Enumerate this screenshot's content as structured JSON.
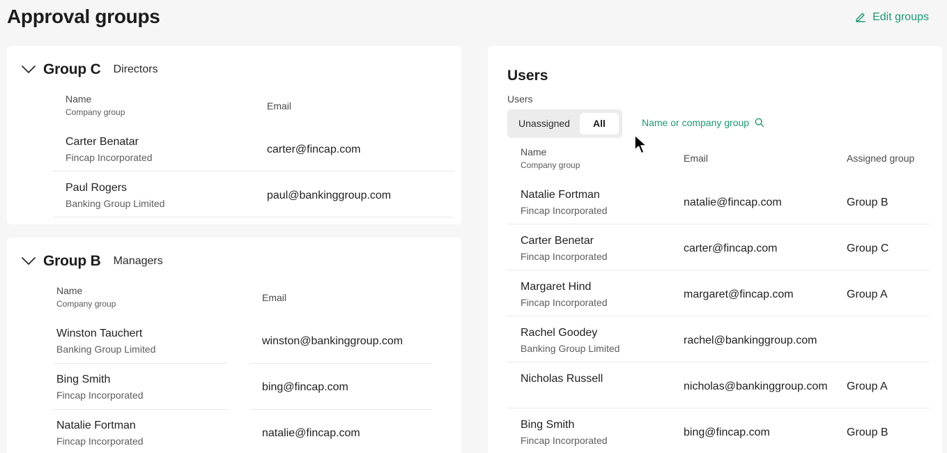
{
  "page": {
    "title": "Approval groups",
    "edit_label": "Edit groups"
  },
  "groups": [
    {
      "name": "Group C",
      "role": "Directors",
      "columns": {
        "name": "Name",
        "sub": "Company group",
        "email": "Email"
      },
      "members": [
        {
          "name": "Carter Benatar",
          "company": "Fincap Incorporated",
          "email": "carter@fincap.com"
        },
        {
          "name": "Paul Rogers",
          "company": "Banking Group Limited",
          "email": "paul@bankinggroup.com"
        }
      ]
    },
    {
      "name": "Group B",
      "role": "Managers",
      "columns": {
        "name": "Name",
        "sub": "Company group",
        "email": "Email"
      },
      "members": [
        {
          "name": "Winston Tauchert",
          "company": "Banking Group Limited",
          "email": "winston@bankinggroup.com"
        },
        {
          "name": "Bing Smith",
          "company": "Fincap Incorporated",
          "email": "bing@fincap.com"
        },
        {
          "name": "Natalie Fortman",
          "company": "Fincap Incorporated",
          "email": "natalie@fincap.com"
        }
      ]
    }
  ],
  "users": {
    "title": "Users",
    "filter_label": "Users",
    "tabs": {
      "unassigned": "Unassigned",
      "all": "All"
    },
    "search_placeholder": "Name or company group",
    "columns": {
      "name": "Name",
      "sub": "Company group",
      "email": "Email",
      "group": "Assigned group"
    },
    "rows": [
      {
        "name": "Natalie Fortman",
        "company": "Fincap Incorporated",
        "email": "natalie@fincap.com",
        "group": "Group B"
      },
      {
        "name": "Carter Benetar",
        "company": "Fincap Incorporated",
        "email": "carter@fincap.com",
        "group": "Group C"
      },
      {
        "name": "Margaret Hind",
        "company": "Fincap Incorporated",
        "email": "margaret@fincap.com",
        "group": "Group A"
      },
      {
        "name": "Rachel Goodey",
        "company": "Banking Group Limited",
        "email": "rachel@bankinggroup.com",
        "group": ""
      },
      {
        "name": "Nicholas Russell",
        "company": "",
        "email": "nicholas@bankinggroup.com",
        "group": "Group A"
      },
      {
        "name": "Bing Smith",
        "company": "Fincap Incorporated",
        "email": "bing@fincap.com",
        "group": "Group B"
      }
    ]
  },
  "colors": {
    "accent": "#1a9a72",
    "background": "#f6f6f6",
    "card": "#ffffff"
  },
  "icons": {
    "edit": "pencil-icon",
    "collapse": "chevron-down-icon",
    "search": "search-icon"
  }
}
